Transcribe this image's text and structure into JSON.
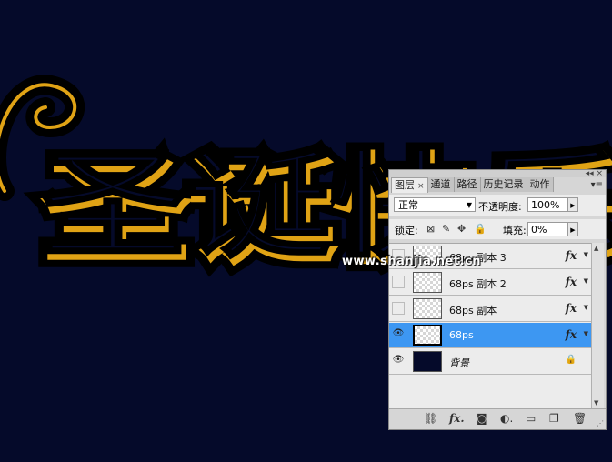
{
  "canvas_title_glyphs": "圣诞快乐",
  "watermark": "www.shanjia.net.cn",
  "colors": {
    "background": "#050a2a",
    "gold": "#e0a315",
    "selected": "#3d97f2"
  },
  "panel": {
    "tabs": [
      {
        "label": "图层",
        "active": true,
        "close": "×"
      },
      {
        "label": "通道"
      },
      {
        "label": "路径"
      },
      {
        "label": "历史记录"
      },
      {
        "label": "动作"
      }
    ],
    "menu_icon": "panel-menu-icon",
    "blend_mode": "正常",
    "opacity_label": "不透明度:",
    "opacity_value": "100%",
    "lock_label": "锁定:",
    "lock_icons": [
      "lock-transparent-icon",
      "lock-brush-icon",
      "lock-move-icon",
      "lock-all-icon"
    ],
    "fill_label": "填充:",
    "fill_value": "0%",
    "layers": [
      {
        "name": "68ps 副本 3",
        "visible": false,
        "fx": "fx",
        "italic": false
      },
      {
        "name": "68ps 副本 2",
        "visible": false,
        "fx": "fx",
        "italic": false
      },
      {
        "name": "68ps 副本",
        "visible": false,
        "fx": "fx",
        "italic": false
      },
      {
        "name": "68ps",
        "visible": true,
        "fx": "fx",
        "selected": true
      },
      {
        "name": "背景",
        "visible": true,
        "locked": true,
        "italic": true
      }
    ],
    "bottom_icons": [
      "link-icon",
      "fx-icon",
      "mask-icon",
      "adjustment-icon",
      "group-icon",
      "new-layer-icon",
      "trash-icon"
    ]
  }
}
